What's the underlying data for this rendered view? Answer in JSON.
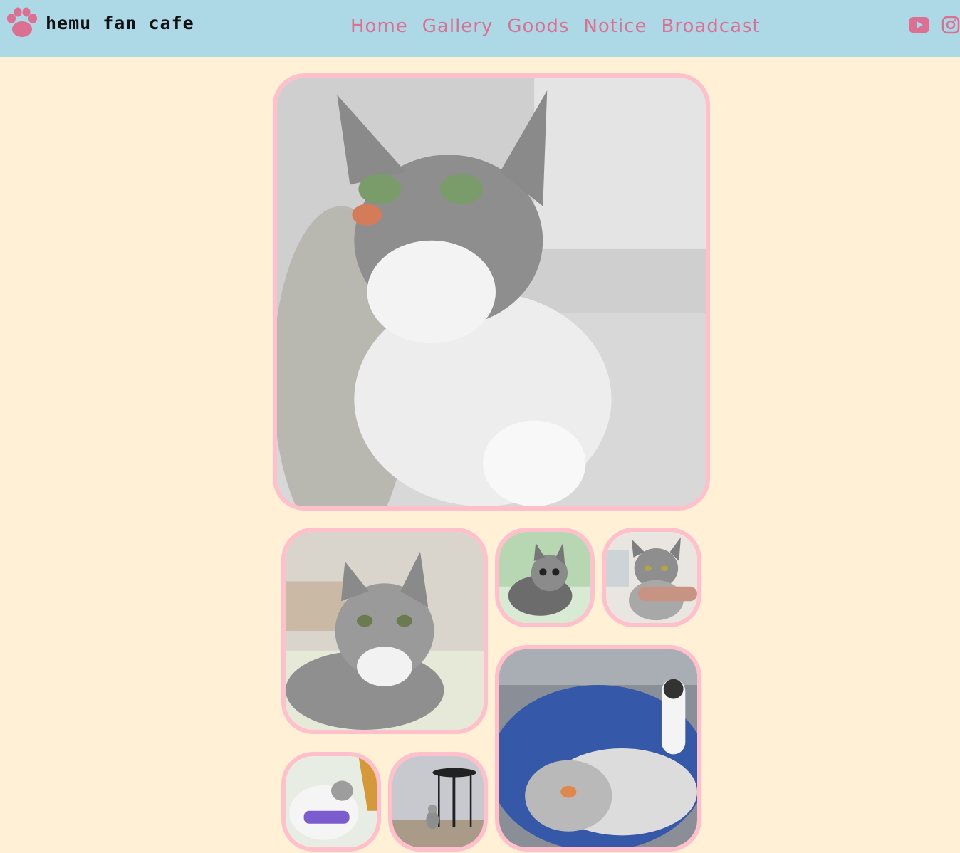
{
  "brand": {
    "name": "hemu fan cafe",
    "logo_icon": "paw-icon"
  },
  "nav": {
    "items": [
      {
        "label": "Home"
      },
      {
        "label": "Gallery"
      },
      {
        "label": "Goods"
      },
      {
        "label": "Notice"
      },
      {
        "label": "Broadcast"
      }
    ]
  },
  "social": {
    "youtube_icon": "youtube-icon",
    "instagram_icon": "instagram-icon"
  },
  "colors": {
    "header_bg": "#add8e6",
    "page_bg": "#fff0d6",
    "accent": "#db7093",
    "photo_border": "#ffc0cb"
  },
  "gallery": {
    "photos": [
      {
        "subject": "tabby cat lying in blanket looking up"
      },
      {
        "subject": "tabby cat lying on bed"
      },
      {
        "subject": "tabby cat on green blanket"
      },
      {
        "subject": "tabby cat being held"
      },
      {
        "subject": "tabby cat lying on blue cushion with paw up"
      },
      {
        "subject": "cat in plastic bag"
      },
      {
        "subject": "cat sitting near table"
      }
    ]
  }
}
